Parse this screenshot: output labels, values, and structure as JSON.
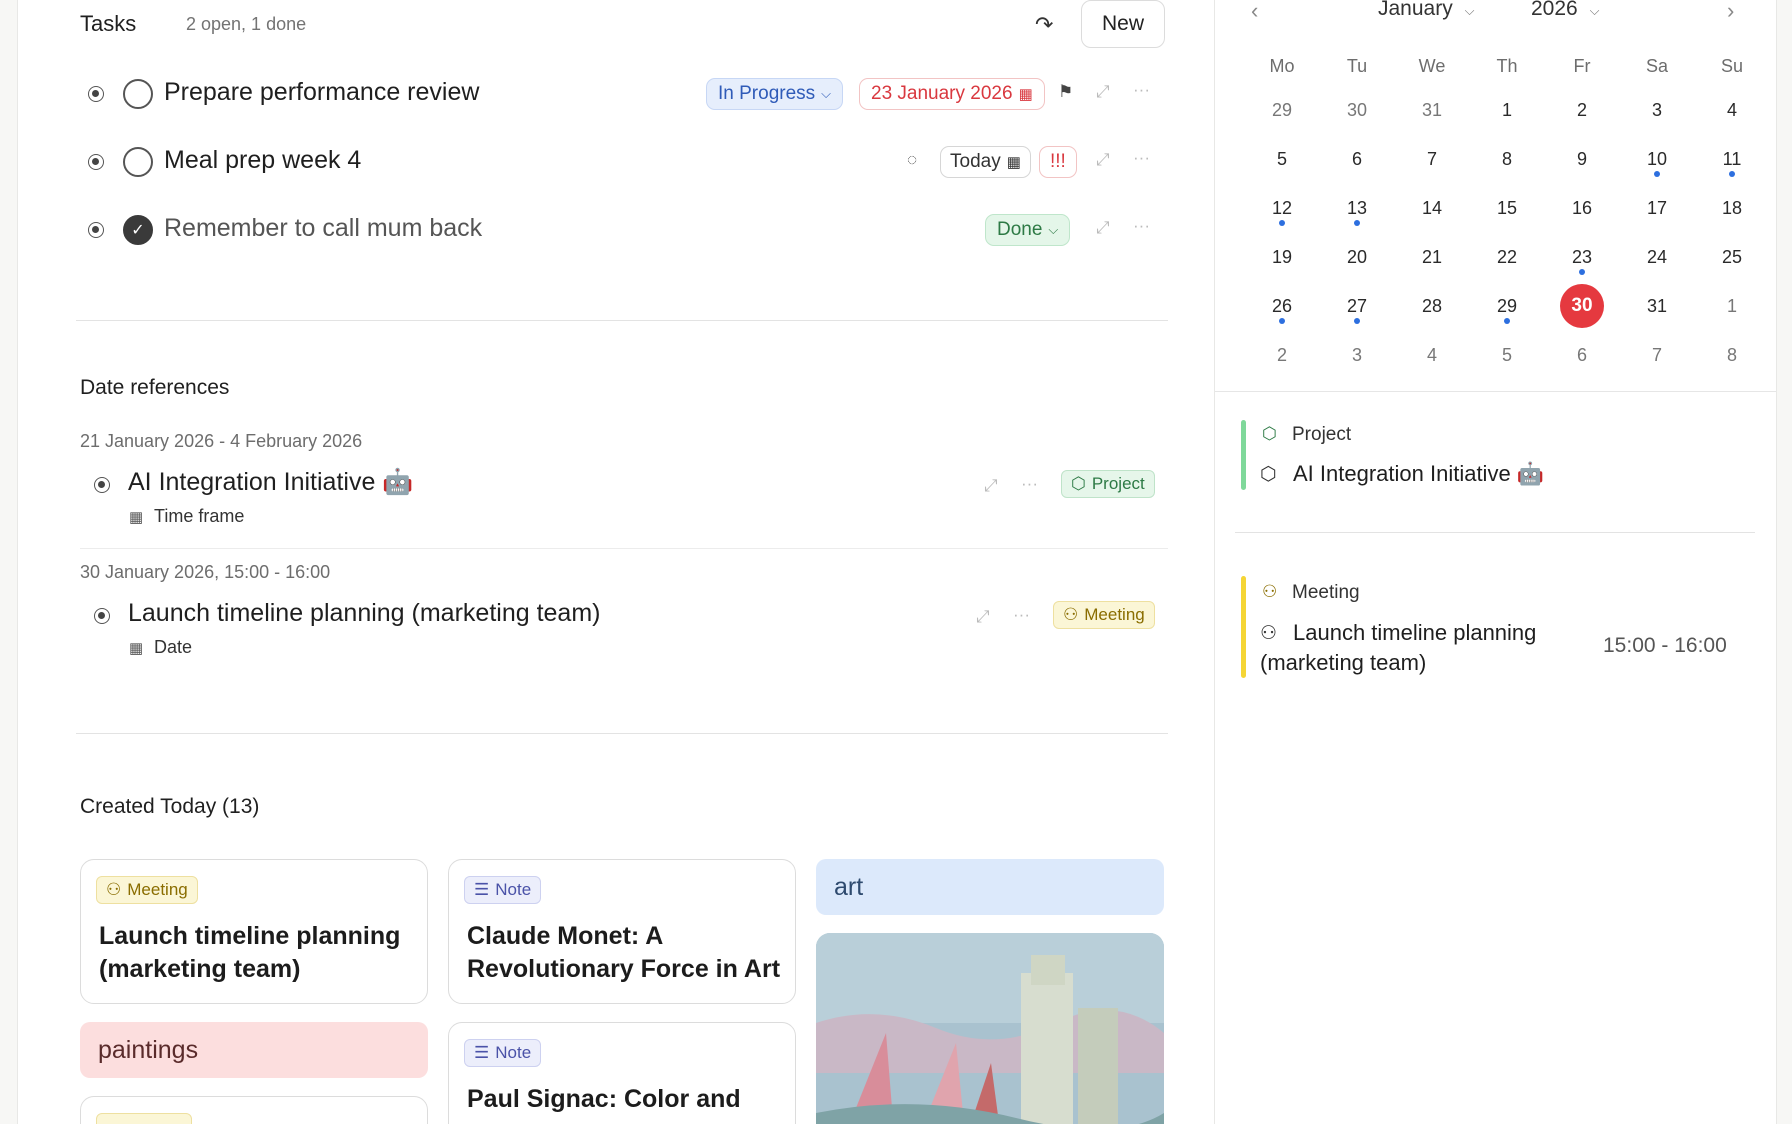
{
  "tasks_header": {
    "title": "Tasks",
    "summary": "2 open, 1 done",
    "new_label": "New"
  },
  "tasks": [
    {
      "title": "Prepare performance review",
      "status": "In Progress",
      "date": "23 January 2026"
    },
    {
      "title": "Meal prep week 4",
      "date": "Today",
      "priority": "!!!"
    },
    {
      "title": "Remember to call mum back",
      "status": "Done"
    }
  ],
  "date_references": {
    "title": "Date references",
    "items": [
      {
        "range": "21 January 2026 - 4 February 2026",
        "title": "AI Integration Initiative",
        "emoji": "🤖",
        "field": "Time frame",
        "tag": "Project"
      },
      {
        "range": "30 January 2026, 15:00 - 16:00",
        "title": "Launch timeline planning (marketing team)",
        "field": "Date",
        "tag": "Meeting"
      }
    ]
  },
  "created_today": {
    "title": "Created Today (13)",
    "cards": [
      {
        "tag": "Meeting",
        "title": "Launch timeline planning (marketing team)"
      },
      {
        "tag": "Note",
        "title": "Claude Monet: A Revolutionary Force in Art"
      },
      {
        "tag": "Note",
        "title": "Paul Signac: Color and"
      }
    ],
    "bands": {
      "art": "art",
      "paintings": "paintings"
    }
  },
  "calendar": {
    "month": "January",
    "year": "2026",
    "weekdays": [
      "Mo",
      "Tu",
      "We",
      "Th",
      "Fr",
      "Sa",
      "Su"
    ],
    "weeks": [
      [
        "29",
        "30",
        "31",
        "1",
        "2",
        "3",
        "4"
      ],
      [
        "5",
        "6",
        "7",
        "8",
        "9",
        "10",
        "11"
      ],
      [
        "12",
        "13",
        "14",
        "15",
        "16",
        "17",
        "18"
      ],
      [
        "19",
        "20",
        "21",
        "22",
        "23",
        "24",
        "25"
      ],
      [
        "26",
        "27",
        "28",
        "29",
        "30",
        "31",
        "1"
      ],
      [
        "2",
        "3",
        "4",
        "5",
        "6",
        "7",
        "8"
      ]
    ]
  },
  "agenda": [
    {
      "type": "Project",
      "title": "AI Integration Initiative",
      "emoji": "🤖",
      "accent": "#7fd89a"
    },
    {
      "type": "Meeting",
      "title": "Launch timeline planning (marketing team)",
      "time": "15:00 - 16:00",
      "accent": "#f5d535"
    }
  ]
}
